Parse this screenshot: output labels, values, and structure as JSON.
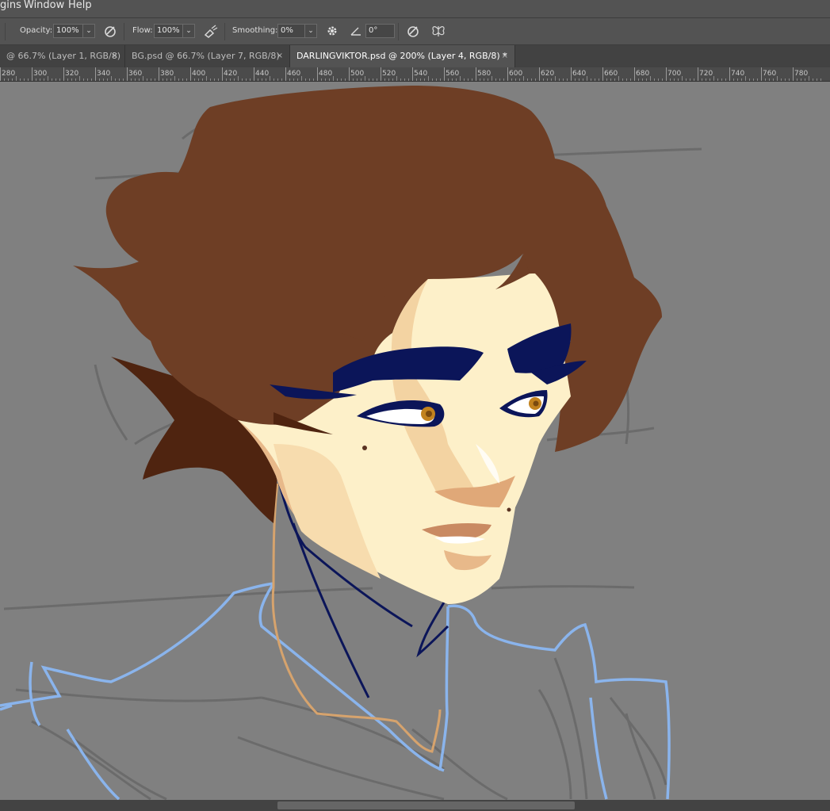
{
  "menubar": {
    "items": [
      "gins",
      "Window",
      "Help"
    ]
  },
  "options": {
    "opacity_label": "Opacity:",
    "opacity_value": "100%",
    "flow_label": "Flow:",
    "flow_value": "100%",
    "smoothing_label": "Smoothing:",
    "smoothing_value": "0%",
    "angle_value": "0°",
    "dropdown_glyph": "⌄",
    "icons": [
      "airbrush-pressure-icon",
      "airbrush-icon",
      "gear-icon",
      "angle-icon",
      "pressure-size-icon",
      "symmetry-butterfly-icon"
    ]
  },
  "tabs": [
    {
      "label": "@ 66.7% (Layer 1, RGB/8)",
      "close": "×"
    },
    {
      "label": "BG.psd @ 66.7% (Layer 7, RGB/8)",
      "close": "×"
    },
    {
      "label": "DARLINGVIKTOR.psd @ 200% (Layer 4, RGB/8) *",
      "close": "×"
    }
  ],
  "ruler": {
    "labels": [
      "280",
      "300",
      "320",
      "340",
      "360",
      "380",
      "400",
      "420",
      "440",
      "460",
      "480",
      "500",
      "520",
      "540",
      "560",
      "580",
      "600",
      "620",
      "640",
      "660",
      "680",
      "700",
      "720",
      "740",
      "760",
      "780"
    ]
  },
  "colors": {
    "canvas_bg": "#808080",
    "hair": "#6e3e25",
    "hair_shadow": "#4f2410",
    "skin": "#fdf0c9",
    "skin_shadow": "#e8b98a",
    "skin_deep": "#c98a62",
    "eyeshadow": "#0b1559",
    "iris": "#c2821e",
    "sketch_blue": "#8ab4ec",
    "sketch_gray": "#696969",
    "line_tan": "#d6a36d"
  }
}
